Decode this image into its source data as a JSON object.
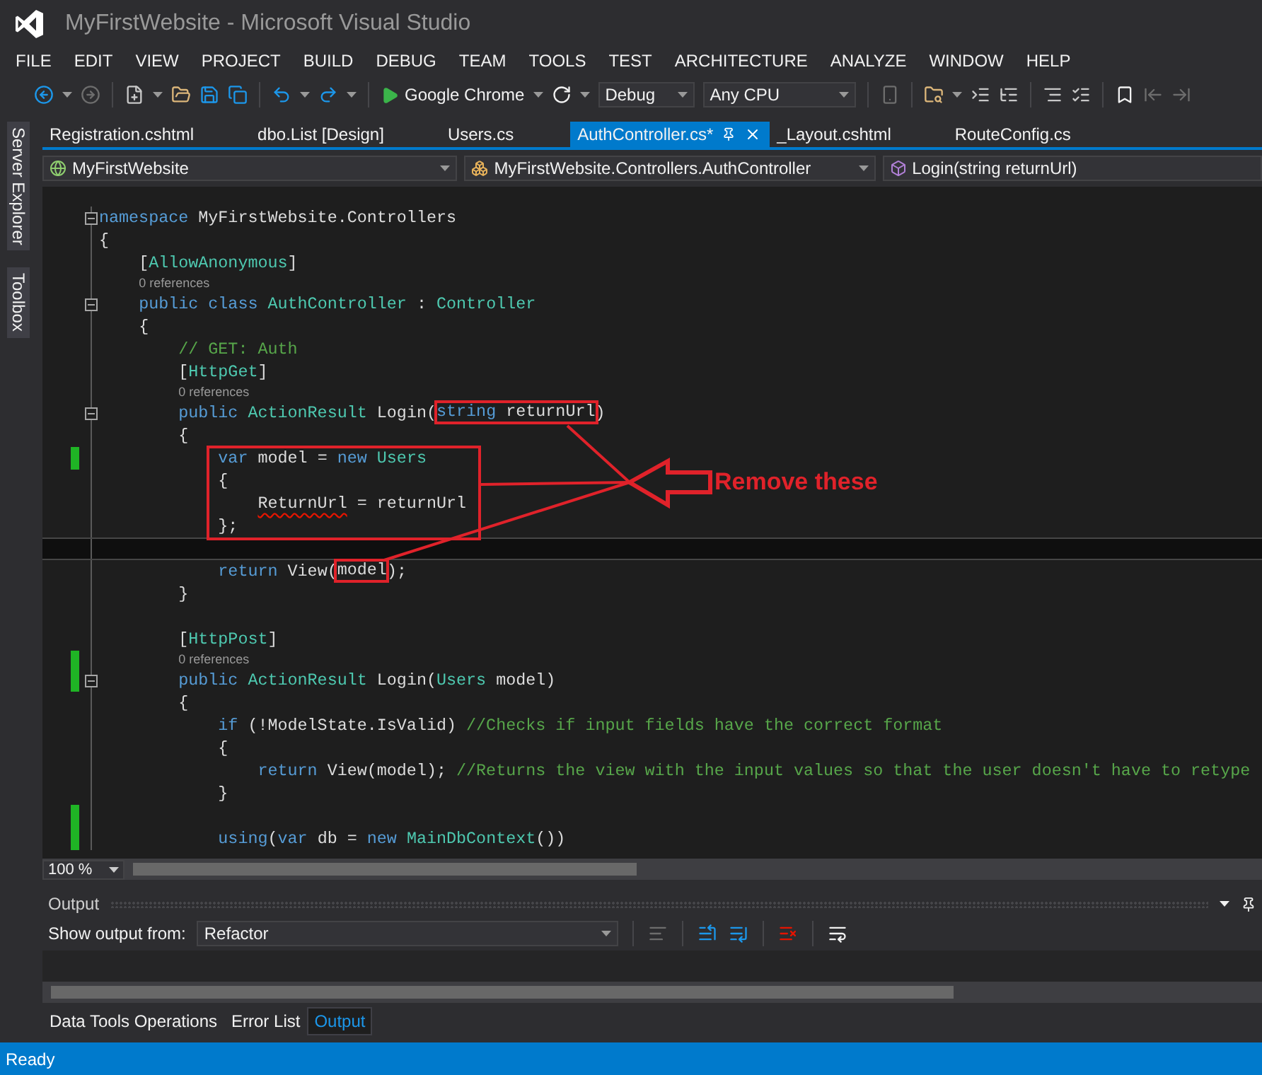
{
  "window": {
    "title": "MyFirstWebsite - Microsoft Visual Studio"
  },
  "menu": [
    "FILE",
    "EDIT",
    "VIEW",
    "PROJECT",
    "BUILD",
    "DEBUG",
    "TEAM",
    "TOOLS",
    "TEST",
    "ARCHITECTURE",
    "ANALYZE",
    "WINDOW",
    "HELP"
  ],
  "toolbar": {
    "run_target": "Google Chrome",
    "configuration": "Debug",
    "platform": "Any CPU"
  },
  "side_tabs": [
    "Server Explorer",
    "Toolbox"
  ],
  "document_tabs": [
    {
      "label": "Registration.cshtml",
      "selected": false
    },
    {
      "label": "dbo.List [Design]",
      "selected": false
    },
    {
      "label": "Users.cs",
      "selected": false
    },
    {
      "label": "AuthController.cs*",
      "selected": true
    },
    {
      "label": "_Layout.cshtml",
      "selected": false
    },
    {
      "label": "RouteConfig.cs",
      "selected": false
    }
  ],
  "navigation_bar": {
    "project": "MyFirstWebsite",
    "type": "MyFirstWebsite.Controllers.AuthController",
    "member": "Login(string returnUrl)"
  },
  "editor": {
    "zoom": "100 %",
    "lines": [
      {
        "kind": "code",
        "fold": true,
        "changed": false,
        "current": false,
        "tokens": [
          {
            "kind": "keyword",
            "text": "namespace"
          },
          {
            "kind": "plain",
            "text": " MyFirstWebsite.Controllers"
          }
        ]
      },
      {
        "kind": "code",
        "fold": false,
        "changed": false,
        "current": false,
        "tokens": [
          {
            "kind": "plain",
            "text": "{"
          }
        ]
      },
      {
        "kind": "code",
        "fold": false,
        "changed": false,
        "current": false,
        "tokens": [
          {
            "kind": "plain",
            "text": "    ["
          },
          {
            "kind": "type",
            "text": "AllowAnonymous"
          },
          {
            "kind": "plain",
            "text": "]"
          }
        ]
      },
      {
        "kind": "references",
        "fold": false,
        "changed": false,
        "current": false,
        "tokens": [
          {
            "kind": "reference",
            "text": "    0 references"
          }
        ]
      },
      {
        "kind": "code",
        "fold": true,
        "changed": false,
        "current": false,
        "tokens": [
          {
            "kind": "keyword",
            "text": "    public class"
          },
          {
            "kind": "type",
            "text": " AuthController"
          },
          {
            "kind": "plain",
            "text": " : "
          },
          {
            "kind": "type",
            "text": "Controller"
          }
        ]
      },
      {
        "kind": "code",
        "fold": false,
        "changed": false,
        "current": false,
        "tokens": [
          {
            "kind": "plain",
            "text": "    {"
          }
        ]
      },
      {
        "kind": "code",
        "fold": false,
        "changed": false,
        "current": false,
        "tokens": [
          {
            "kind": "comment",
            "text": "        // GET: Auth"
          }
        ]
      },
      {
        "kind": "code",
        "fold": false,
        "changed": false,
        "current": false,
        "tokens": [
          {
            "kind": "plain",
            "text": "        ["
          },
          {
            "kind": "type",
            "text": "HttpGet"
          },
          {
            "kind": "plain",
            "text": "]"
          }
        ]
      },
      {
        "kind": "references",
        "fold": false,
        "changed": false,
        "current": false,
        "tokens": [
          {
            "kind": "reference",
            "text": "        0 references"
          }
        ]
      },
      {
        "kind": "code",
        "fold": true,
        "changed": false,
        "current": false,
        "tokens": [
          {
            "kind": "keyword",
            "text": "        public"
          },
          {
            "kind": "type",
            "text": " ActionResult"
          },
          {
            "kind": "plain",
            "text": " Login("
          },
          {
            "kind": "keyword",
            "text": "string",
            "boxed": true
          },
          {
            "kind": "plain",
            "text": " returnUrl",
            "boxed": true
          },
          {
            "kind": "plain",
            "text": ")"
          }
        ]
      },
      {
        "kind": "code",
        "fold": false,
        "changed": false,
        "current": false,
        "tokens": [
          {
            "kind": "plain",
            "text": "        {"
          }
        ]
      },
      {
        "kind": "block",
        "boxed": true,
        "lines": [
          {
            "kind": "code",
            "fold": false,
            "changed": true,
            "current": false,
            "tokens": [
              {
                "kind": "keyword",
                "text": "            var"
              },
              {
                "kind": "plain",
                "text": " model = "
              },
              {
                "kind": "keyword",
                "text": "new"
              },
              {
                "kind": "type",
                "text": " Users"
              }
            ]
          },
          {
            "kind": "code",
            "fold": false,
            "changed": false,
            "current": false,
            "tokens": [
              {
                "kind": "plain",
                "text": "            {"
              }
            ]
          },
          {
            "kind": "code",
            "fold": false,
            "changed": false,
            "current": false,
            "tokens": [
              {
                "kind": "plain",
                "text": "                ReturnUrl",
                "squiggle": true
              },
              {
                "kind": "plain",
                "text": " = returnUrl"
              }
            ]
          },
          {
            "kind": "code",
            "fold": false,
            "changed": false,
            "current": false,
            "tokens": [
              {
                "kind": "plain",
                "text": "            };"
              }
            ]
          }
        ]
      },
      {
        "kind": "code",
        "fold": false,
        "changed": false,
        "current": true
      },
      {
        "kind": "code",
        "fold": false,
        "changed": false,
        "current": false,
        "tokens": [
          {
            "kind": "keyword",
            "text": "            return"
          },
          {
            "kind": "plain",
            "text": " View("
          },
          {
            "kind": "plain",
            "text": "model",
            "boxed": true
          },
          {
            "kind": "plain",
            "text": ");"
          }
        ]
      },
      {
        "kind": "code",
        "fold": false,
        "changed": false,
        "current": false,
        "tokens": [
          {
            "kind": "plain",
            "text": "        }"
          }
        ]
      },
      {
        "kind": "code",
        "fold": false,
        "changed": false,
        "current": false
      },
      {
        "kind": "code",
        "fold": false,
        "changed": false,
        "current": false,
        "tokens": [
          {
            "kind": "plain",
            "text": "        ["
          },
          {
            "kind": "type",
            "text": "HttpPost"
          },
          {
            "kind": "plain",
            "text": "]"
          }
        ]
      },
      {
        "kind": "references",
        "fold": false,
        "changed": true,
        "current": false,
        "tokens": [
          {
            "kind": "reference",
            "text": "        0 references"
          }
        ]
      },
      {
        "kind": "code",
        "fold": true,
        "changed": true,
        "current": false,
        "tokens": [
          {
            "kind": "keyword",
            "text": "        public"
          },
          {
            "kind": "type",
            "text": " ActionResult"
          },
          {
            "kind": "plain",
            "text": " Login("
          },
          {
            "kind": "type",
            "text": "Users"
          },
          {
            "kind": "plain",
            "text": " model)"
          }
        ]
      },
      {
        "kind": "code",
        "fold": false,
        "changed": false,
        "current": false,
        "tokens": [
          {
            "kind": "plain",
            "text": "        {"
          }
        ]
      },
      {
        "kind": "code",
        "fold": false,
        "changed": false,
        "current": false,
        "tokens": [
          {
            "kind": "keyword",
            "text": "            if"
          },
          {
            "kind": "plain",
            "text": " (!ModelState.IsValid) "
          },
          {
            "kind": "comment",
            "text": "//Checks if input fields have the correct format"
          }
        ]
      },
      {
        "kind": "code",
        "fold": false,
        "changed": false,
        "current": false,
        "tokens": [
          {
            "kind": "plain",
            "text": "            {"
          }
        ]
      },
      {
        "kind": "code",
        "fold": false,
        "changed": false,
        "current": false,
        "tokens": [
          {
            "kind": "keyword",
            "text": "                return"
          },
          {
            "kind": "plain",
            "text": " View(model); "
          },
          {
            "kind": "comment",
            "text": "//Returns the view with the input values so that the user doesn't have to retype"
          }
        ]
      },
      {
        "kind": "code",
        "fold": false,
        "changed": false,
        "current": false,
        "tokens": [
          {
            "kind": "plain",
            "text": "            }"
          }
        ]
      },
      {
        "kind": "code",
        "fold": false,
        "changed": true,
        "current": false
      },
      {
        "kind": "code",
        "fold": false,
        "changed": true,
        "current": false,
        "tokens": [
          {
            "kind": "keyword",
            "text": "            using"
          },
          {
            "kind": "plain",
            "text": "("
          },
          {
            "kind": "keyword",
            "text": "var"
          },
          {
            "kind": "plain",
            "text": " db = "
          },
          {
            "kind": "keyword",
            "text": "new"
          },
          {
            "kind": "type",
            "text": " MainDbContext"
          },
          {
            "kind": "plain",
            "text": "())"
          }
        ]
      }
    ]
  },
  "annotation": {
    "label": "Remove these"
  },
  "output": {
    "title": "Output",
    "source_label": "Show output from:",
    "source": "Refactor"
  },
  "bottom_tabs": [
    {
      "label": "Data Tools Operations",
      "selected": false
    },
    {
      "label": "Error List",
      "selected": false
    },
    {
      "label": "Output",
      "selected": true
    }
  ],
  "status_bar": {
    "text": "Ready"
  }
}
